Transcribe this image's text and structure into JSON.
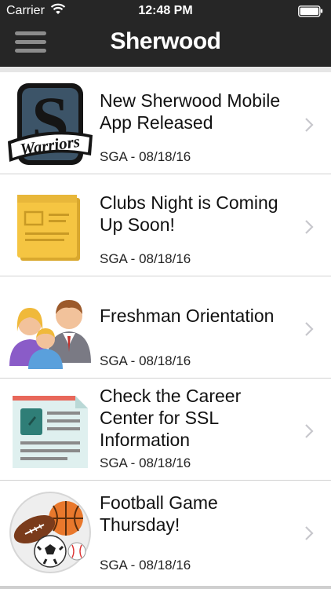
{
  "status": {
    "carrier": "Carrier",
    "time": "12:48 PM"
  },
  "nav": {
    "title": "Sherwood",
    "menu_icon": "hamburger-menu-icon"
  },
  "items": [
    {
      "title": "New Sherwood Mobile App Released",
      "meta": "SGA - 08/18/16",
      "icon": "warriors-logo-icon",
      "logo_text": "Warriors"
    },
    {
      "title": "Clubs Night is Coming Up Soon!",
      "meta": "SGA - 08/18/16",
      "icon": "notice-card-icon"
    },
    {
      "title": "Freshman Orientation",
      "meta": "SGA - 08/18/16",
      "icon": "people-group-icon"
    },
    {
      "title": "Check the Career Center for SSL Information",
      "meta": "SGA - 08/18/16",
      "icon": "document-icon"
    },
    {
      "title": "Football Game Thursday!",
      "meta": "SGA - 08/18/16",
      "icon": "sports-balls-icon"
    }
  ],
  "colors": {
    "bar": "#262626",
    "logo_blue": "#3c5468",
    "card_yellow": "#f5c542",
    "chevron": "#c7c7cc"
  }
}
